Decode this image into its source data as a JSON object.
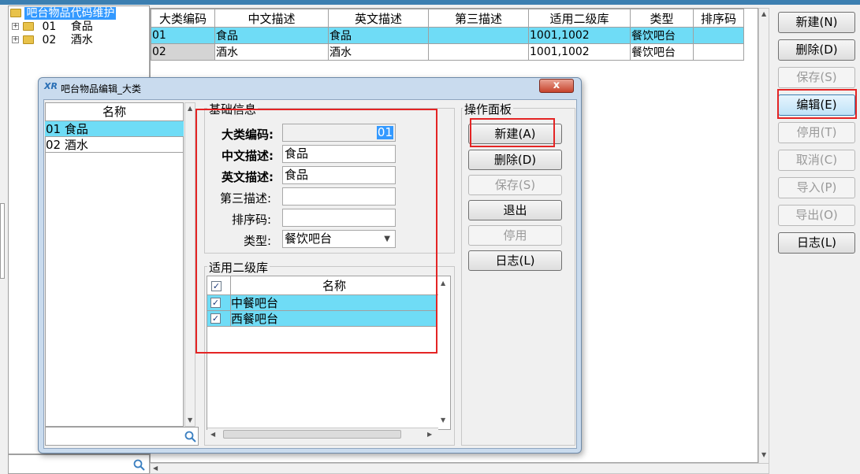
{
  "tree": {
    "root_label": "吧台物品代码维护",
    "items": [
      {
        "code": "01",
        "name": "食品"
      },
      {
        "code": "02",
        "name": "酒水"
      }
    ]
  },
  "grid": {
    "columns": [
      "大类编码",
      "中文描述",
      "英文描述",
      "第三描述",
      "适用二级库",
      "类型",
      "排序码"
    ],
    "rows": [
      {
        "code": "01",
        "cn": "食品",
        "en": "食品",
        "third": "",
        "libs": "1001,1002",
        "type": "餐饮吧台",
        "sort": ""
      },
      {
        "code": "02",
        "cn": "酒水",
        "en": "酒水",
        "third": "",
        "libs": "1001,1002",
        "type": "餐饮吧台",
        "sort": ""
      }
    ]
  },
  "right_buttons": {
    "new": "新建(N)",
    "delete": "删除(D)",
    "save": "保存(S)",
    "edit": "编辑(E)",
    "disable": "停用(T)",
    "cancel": "取消(C)",
    "import": "导入(P)",
    "export": "导出(O)",
    "log": "日志(L)"
  },
  "dialog": {
    "title": "吧台物品编辑_大类",
    "logo": "XR",
    "close": "x",
    "list": {
      "header": "名称",
      "items": [
        "01 食品",
        "02 酒水"
      ]
    },
    "basic": {
      "title": "基础信息",
      "code_label": "大类编码:",
      "code_value": "01",
      "cn_label": "中文描述:",
      "cn_value": "食品",
      "en_label": "英文描述:",
      "en_value": "食品",
      "third_label": "第三描述:",
      "third_value": "",
      "sort_label": "排序码:",
      "sort_value": "",
      "type_label": "类型:",
      "type_value": "餐饮吧台"
    },
    "libs": {
      "title": "适用二级库",
      "header": "名称",
      "rows": [
        "中餐吧台",
        "西餐吧台"
      ]
    },
    "ops": {
      "title": "操作面板",
      "new": "新建(A)",
      "delete": "删除(D)",
      "save": "保存(S)",
      "exit": "退出",
      "disable": "停用",
      "log": "日志(L)"
    }
  },
  "colors": {
    "selection": "#6fdcf6",
    "tree_highlight": "#3399ff",
    "annotation": "#e42424"
  }
}
